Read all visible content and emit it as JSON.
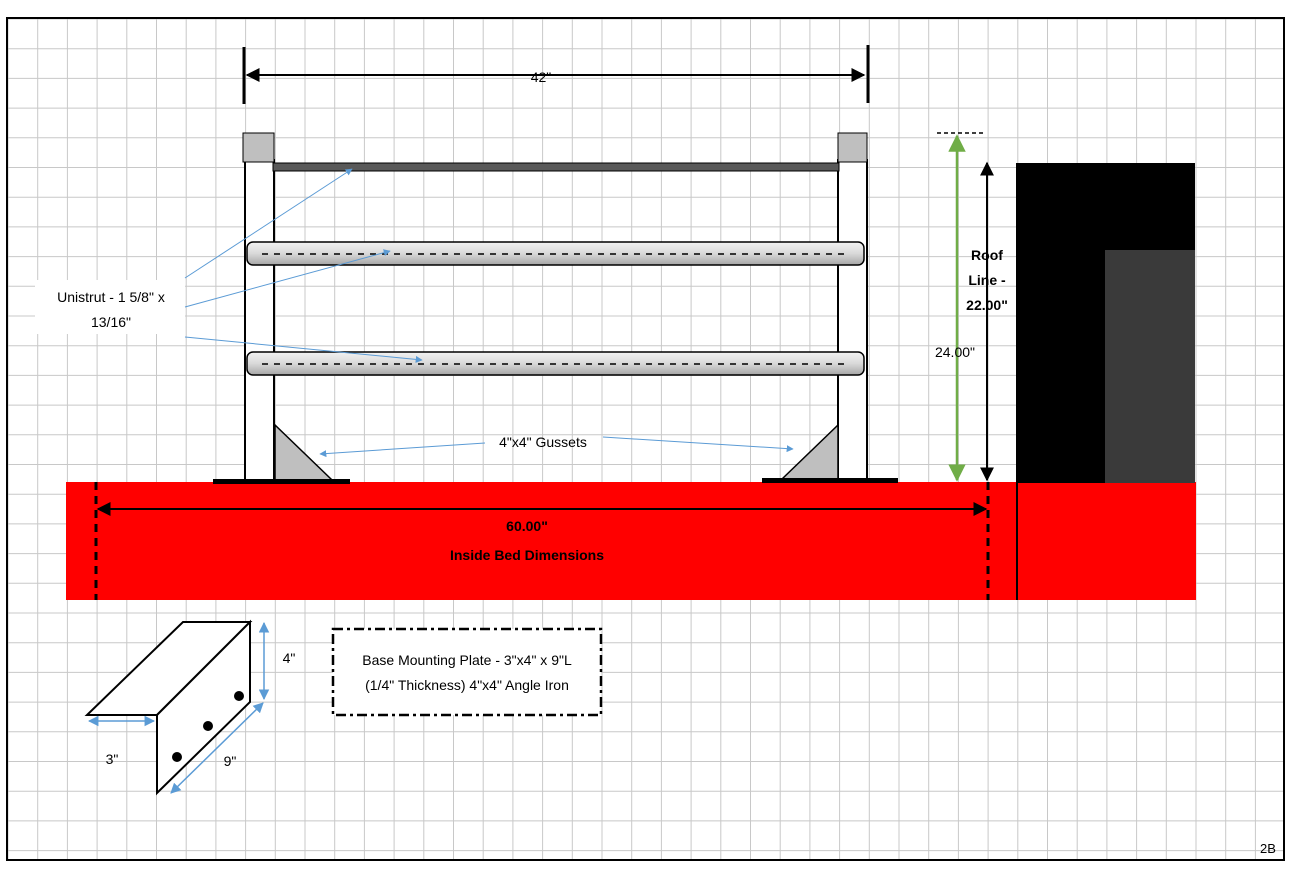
{
  "labels": {
    "width_top": "42\"",
    "unistrut_line1": "Unistrut - 1 5/8\" x",
    "unistrut_line2": "13/16\"",
    "roof_line1": "Roof",
    "roof_line2": "Line -",
    "roof_line3": "22.00\"",
    "height_24": "24.00\"",
    "gussets": "4\"x4\" Gussets",
    "bed_width": "60.00\"",
    "bed_caption": "Inside Bed Dimensions",
    "plate_line1": "Base Mounting Plate - 3\"x4\" x 9\"L",
    "plate_line2": "(1/4\" Thickness) 4\"x4\" Angle Iron",
    "dim_4": "4\"",
    "dim_3": "3\"",
    "dim_9": "9\"",
    "page_tag": "2B"
  },
  "colors": {
    "bed": "#ff0000",
    "cab": "#000000",
    "cab_window": "#3a3a3a",
    "grid": "#c8c8c8",
    "callout": "#5b9bd5",
    "height_arrow": "#70ad47"
  }
}
